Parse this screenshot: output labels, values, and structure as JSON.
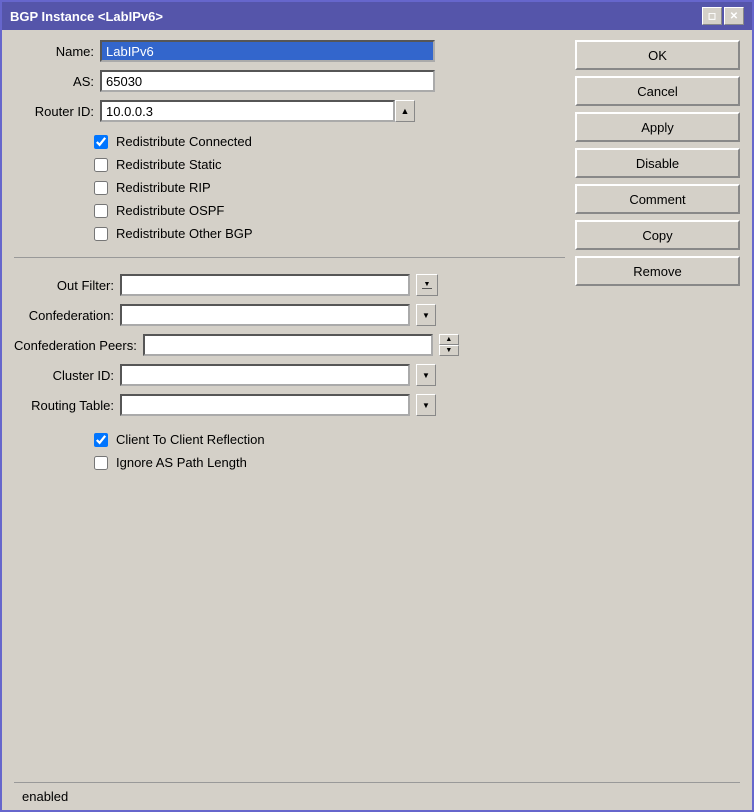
{
  "window": {
    "title": "BGP Instance <LabIPv6>",
    "controls": {
      "restore": "🗗",
      "close": "✕"
    }
  },
  "fields": {
    "name_label": "Name:",
    "name_value": "LabIPv6",
    "as_label": "AS:",
    "as_value": "65030",
    "router_id_label": "Router ID:",
    "router_id_value": "10.0.0.3"
  },
  "checkboxes": [
    {
      "id": "redistribute-connected",
      "label": "Redistribute Connected",
      "checked": true
    },
    {
      "id": "redistribute-static",
      "label": "Redistribute Static",
      "checked": false
    },
    {
      "id": "redistribute-rip",
      "label": "Redistribute RIP",
      "checked": false
    },
    {
      "id": "redistribute-ospf",
      "label": "Redistribute OSPF",
      "checked": false
    },
    {
      "id": "redistribute-other-bgp",
      "label": "Redistribute Other BGP",
      "checked": false
    }
  ],
  "filters": [
    {
      "id": "out-filter",
      "label": "Out Filter:",
      "value": "",
      "type": "outfilter"
    },
    {
      "id": "confederation",
      "label": "Confederation:",
      "value": "",
      "type": "dropdown"
    },
    {
      "id": "confederation-peers",
      "label": "Confederation Peers:",
      "value": "",
      "type": "spinbox"
    },
    {
      "id": "cluster-id",
      "label": "Cluster ID:",
      "value": "",
      "type": "dropdown"
    },
    {
      "id": "routing-table",
      "label": "Routing Table:",
      "value": "",
      "type": "dropdown"
    }
  ],
  "bottom_checkboxes": [
    {
      "id": "client-to-client",
      "label": "Client To Client Reflection",
      "checked": true
    },
    {
      "id": "ignore-as-path",
      "label": "Ignore AS Path Length",
      "checked": false
    }
  ],
  "buttons": {
    "ok": "OK",
    "cancel": "Cancel",
    "apply": "Apply",
    "disable": "Disable",
    "comment": "Comment",
    "copy": "Copy",
    "remove": "Remove"
  },
  "status": {
    "text": "enabled"
  }
}
